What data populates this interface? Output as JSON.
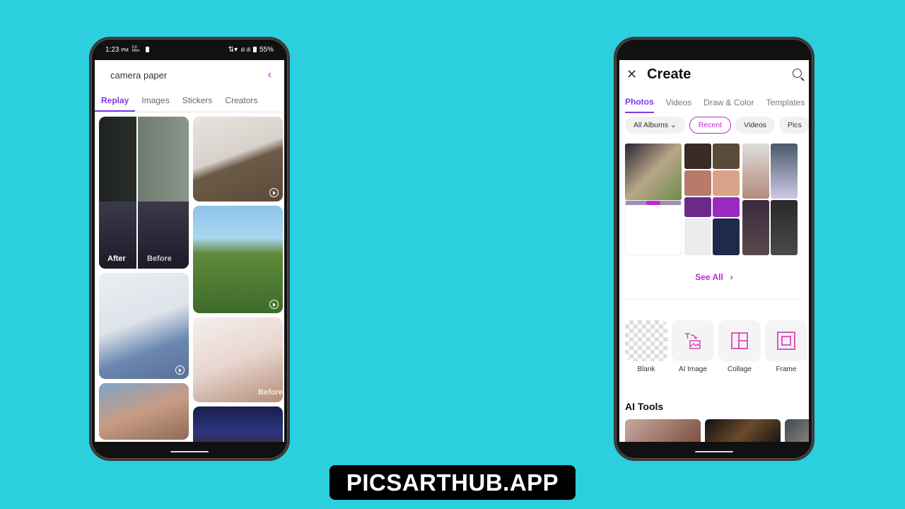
{
  "left_phone": {
    "status": {
      "time": "1:23",
      "ampm": "PM",
      "speed": "0.0 KB/s",
      "battery": "55%"
    },
    "search": {
      "query": "camera paper",
      "back_icon": "chevron-left-icon"
    },
    "tabs": [
      {
        "label": "Replay",
        "active": true
      },
      {
        "label": "Images",
        "active": false
      },
      {
        "label": "Stickers",
        "active": false
      },
      {
        "label": "Creators",
        "active": false
      }
    ],
    "cards": [
      {
        "label_after": "After",
        "label_before": "Before"
      },
      {
        "icon": "replay-icon"
      },
      {
        "icon": "replay-icon"
      },
      {
        "icon": "replay-icon"
      },
      {
        "label_before": "Before"
      },
      {},
      {}
    ]
  },
  "right_phone": {
    "header": {
      "title": "Create",
      "close_icon": "close-icon",
      "search_icon": "search-icon"
    },
    "tabs": [
      {
        "label": "Photos",
        "active": true
      },
      {
        "label": "Videos",
        "active": false
      },
      {
        "label": "Draw & Color",
        "active": false
      },
      {
        "label": "Templates",
        "active": false
      }
    ],
    "chips": [
      {
        "label": "All Albums",
        "dropdown": true
      },
      {
        "label": "Recent",
        "active": true
      },
      {
        "label": "Videos"
      },
      {
        "label": "Pics"
      }
    ],
    "see_all": "See All",
    "tools": [
      {
        "label": "Blank",
        "icon": "transparent-canvas-icon"
      },
      {
        "label": "AI Image",
        "icon": "text-to-image-icon"
      },
      {
        "label": "Collage",
        "icon": "collage-icon"
      },
      {
        "label": "Frame",
        "icon": "frame-icon"
      }
    ],
    "ai_tools_title": "AI Tools"
  },
  "banner": {
    "text": "PICSARTHUB.APP"
  },
  "colors": {
    "background": "#2ccfdd",
    "accent_purple": "#7c3aed",
    "accent_magenta": "#c026d3"
  }
}
